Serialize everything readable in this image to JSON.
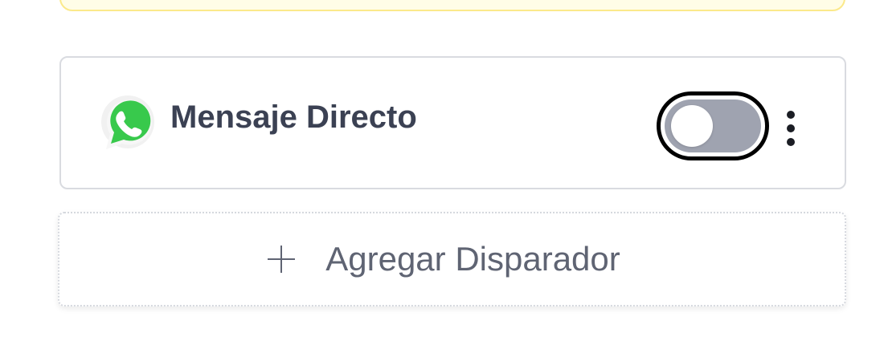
{
  "trigger": {
    "icon": "whatsapp-icon",
    "title": "Mensaje Directo",
    "enabled": false,
    "menu_icon": "kebab-menu-icon"
  },
  "add_trigger": {
    "icon": "plus-icon",
    "label": "Agregar Disparador"
  },
  "colors": {
    "whatsapp_green": "#38c94c",
    "text_primary": "#3b4153",
    "text_secondary": "#5f6473",
    "toggle_off": "#9fa3b0",
    "notice_background": "#fffde7",
    "notice_border": "#fbe98a"
  }
}
